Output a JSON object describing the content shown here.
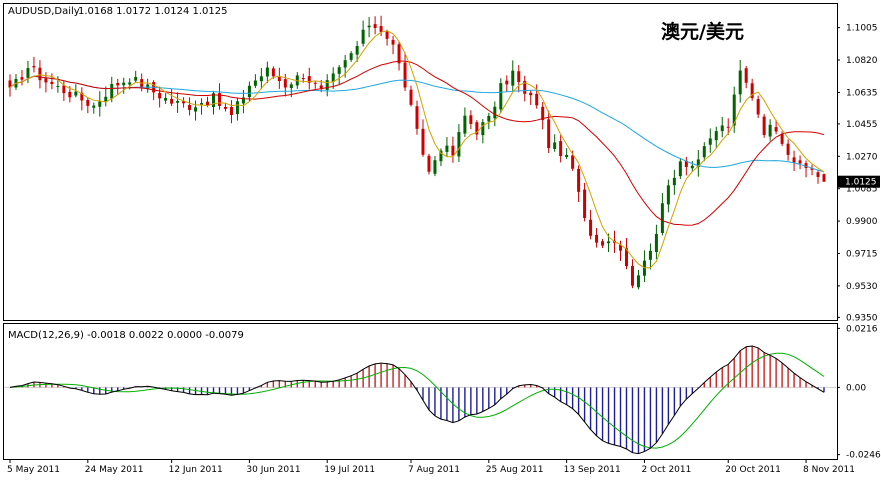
{
  "price_panel": {
    "symbol_label": "AUDUSD,Daily",
    "ohlc_label": "1.0168 1.0172 1.0124 1.0125",
    "pair_title": "澳元/美元",
    "current_price_label": "1.0125"
  },
  "macd_panel": {
    "label": "MACD(12,26,9) -0.0018 0.0022 0.0000 -0.0079"
  },
  "colors": {
    "bull_candle": "#006400",
    "bear_candle": "#cc0000",
    "ma_fast": "#d4a000",
    "ma_mid": "#d40000",
    "ma_slow": "#1ea7e0",
    "hist_pos": "#cc2222",
    "hist_neg": "#1c1c9c",
    "macd_line": "#000000",
    "signal_line": "#00b000",
    "price_box_bg": "#000000",
    "price_box_text": "#ffffff"
  },
  "chart_data": [
    {
      "type": "candlestick",
      "x_tick_labels": [
        "5 May 2011",
        "24 May 2011",
        "12 Jun 2011",
        "30 Jun 2011",
        "19 Jul 2011",
        "7 Aug 2011",
        "25 Aug 2011",
        "13 Sep 2011",
        "2 Oct 2011",
        "20 Oct 2011",
        "8 Nov 2011"
      ],
      "y_tick_labels": [
        "1.1005",
        "1.0820",
        "1.0635",
        "1.0455",
        "1.0270",
        "1.0085",
        "0.9900",
        "0.9715",
        "0.9530",
        "0.9350"
      ],
      "ylim": [
        0.9335,
        1.114
      ],
      "y_ticks": [
        1.1005,
        1.082,
        1.0635,
        1.0455,
        1.027,
        1.0085,
        0.99,
        0.9715,
        0.953,
        0.935
      ],
      "candles": [],
      "overlays": [
        {
          "name": "",
          "kind": "moving-average",
          "color": "#d4a000"
        },
        {
          "name": "",
          "kind": "moving-average",
          "color": "#d40000"
        },
        {
          "name": "",
          "kind": "moving-average",
          "color": "#1ea7e0"
        }
      ],
      "last_close": 1.0125
    },
    {
      "type": "bar+line",
      "y_tick_labels": [
        "0.0216",
        "0.00",
        "-0.0246"
      ],
      "y_ticks": [
        0.0216,
        0.0,
        -0.0246
      ],
      "ylim": [
        -0.0262,
        0.0232
      ],
      "histogram": [],
      "macd_line": [],
      "signal_line": []
    }
  ]
}
